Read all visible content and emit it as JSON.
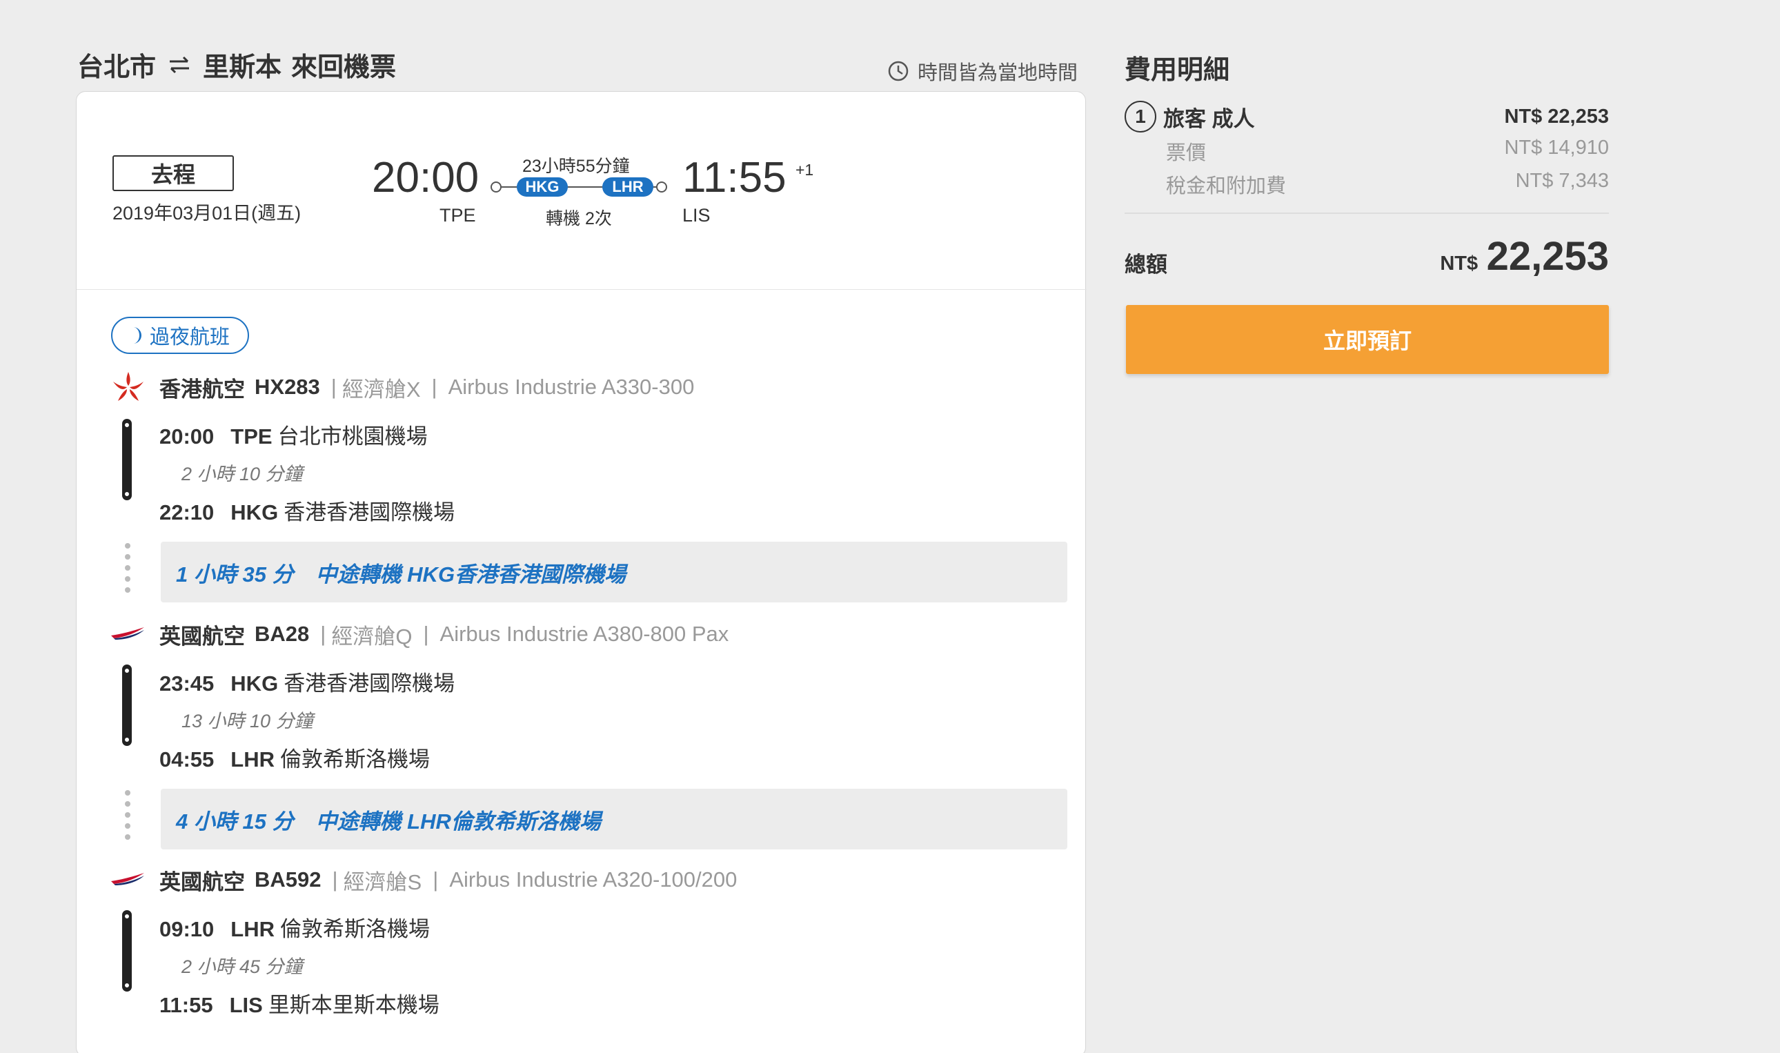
{
  "header": {
    "origin": "台北市",
    "destination": "里斯本",
    "trip_type": "來回機票",
    "timezone_note": "時間皆為當地時間"
  },
  "summary": {
    "direction": "去程",
    "date": "2019年03月01日(週五)",
    "depart_time": "20:00",
    "depart_code": "TPE",
    "arrive_time": "11:55",
    "day_offset": "+1",
    "arrive_code": "LIS",
    "duration": "23小時55分鐘",
    "stop_codes": [
      "HKG",
      "LHR"
    ],
    "stops_text": "轉機 2次"
  },
  "overnight_badge": "過夜航班",
  "segments": [
    {
      "airline": "香港航空",
      "flight": "HX283",
      "cabin": "經濟艙X",
      "aircraft": "Airbus Industrie A330-300",
      "dep_time": "20:00",
      "dep_code": "TPE",
      "dep_airport": "台北市桃園機場",
      "duration": "2 小時 10 分鐘",
      "arr_time": "22:10",
      "arr_code": "HKG",
      "arr_airport": "香港香港國際機場"
    },
    {
      "airline": "英國航空",
      "flight": "BA28",
      "cabin": "經濟艙Q",
      "aircraft": "Airbus Industrie A380-800 Pax",
      "dep_time": "23:45",
      "dep_code": "HKG",
      "dep_airport": "香港香港國際機場",
      "duration": "13 小時 10 分鐘",
      "arr_time": "04:55",
      "arr_code": "LHR",
      "arr_airport": "倫敦希斯洛機場"
    },
    {
      "airline": "英國航空",
      "flight": "BA592",
      "cabin": "經濟艙S",
      "aircraft": "Airbus Industrie A320-100/200",
      "dep_time": "09:10",
      "dep_code": "LHR",
      "dep_airport": "倫敦希斯洛機場",
      "duration": "2 小時 45 分鐘",
      "arr_time": "11:55",
      "arr_code": "LIS",
      "arr_airport": "里斯本里斯本機場"
    }
  ],
  "layovers": [
    {
      "duration": "1 小時 35 分",
      "text": "中途轉機 HKG香港香港國際機場"
    },
    {
      "duration": "4 小時 15 分",
      "text": "中途轉機 LHR倫敦希斯洛機場"
    }
  ],
  "fees": {
    "title": "費用明細",
    "traveler_count": "1",
    "traveler_label": "旅客 成人",
    "traveler_total": "NT$ 22,253",
    "fare_label": "票價",
    "fare_value": "NT$ 14,910",
    "tax_label": "稅金和附加費",
    "tax_value": "NT$ 7,343",
    "total_label": "總額",
    "total_currency": "NT$",
    "total_value": "22,253",
    "book_button": "立即預訂"
  },
  "colors": {
    "accent_blue": "#1d72c2",
    "book_orange": "#f5a034",
    "hk_airlines_red": "#d42a20",
    "ba_red": "#c8102e",
    "ba_navy": "#1b2d6b"
  }
}
